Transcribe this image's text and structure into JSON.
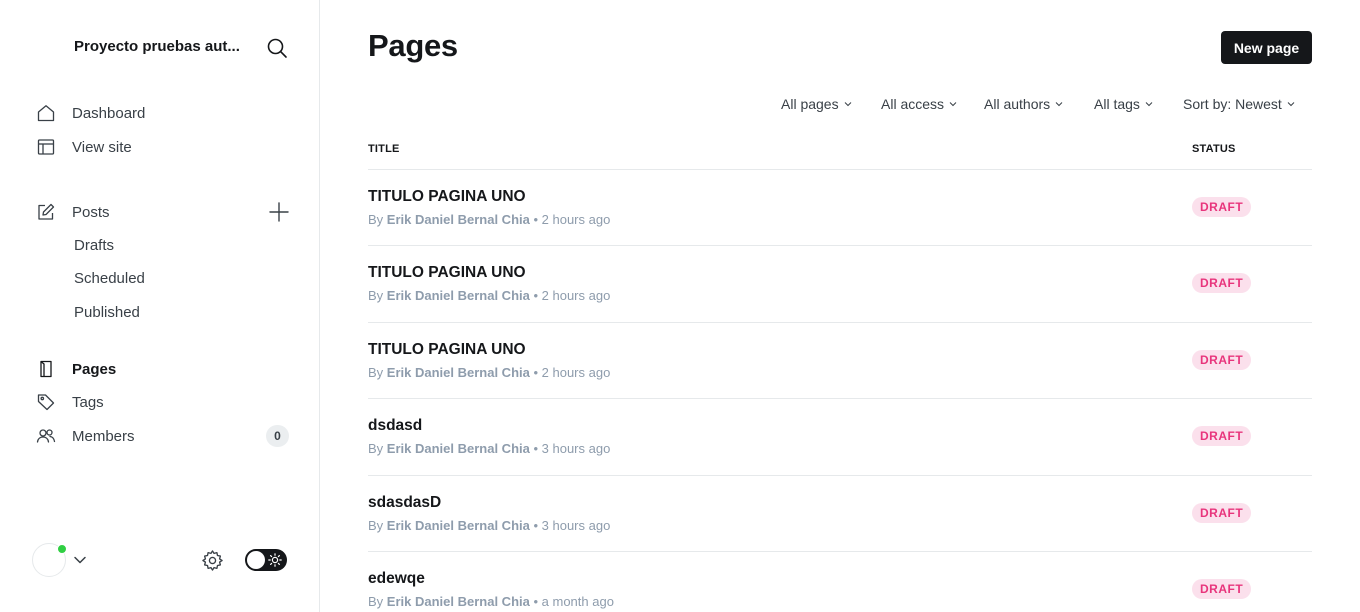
{
  "sidebar": {
    "site_title": "Proyecto pruebas aut...",
    "nav": {
      "dashboard": "Dashboard",
      "view_site": "View site",
      "posts": "Posts",
      "drafts": "Drafts",
      "scheduled": "Scheduled",
      "published": "Published",
      "pages": "Pages",
      "tags": "Tags",
      "members": "Members"
    },
    "members_count": "0",
    "active_item": "pages",
    "icons": [
      "search-icon",
      "home-icon",
      "layout-icon",
      "edit-icon",
      "plus-icon",
      "page-icon",
      "tag-icon",
      "members-icon",
      "chevron-down-icon",
      "gear-icon",
      "sun-icon"
    ]
  },
  "main": {
    "title": "Pages",
    "new_button": "New page",
    "filters": {
      "type": "All pages",
      "access": "All access",
      "authors": "All authors",
      "tags": "All tags",
      "sort": "Sort by: Newest"
    },
    "columns": {
      "title": "TITLE",
      "status": "STATUS"
    },
    "rows": [
      {
        "title": "TITULO PAGINA UNO",
        "by": "By",
        "author": "Erik Daniel Bernal Chia",
        "time": "• 2 hours ago",
        "status": "DRAFT"
      },
      {
        "title": "TITULO PAGINA UNO",
        "by": "By",
        "author": "Erik Daniel Bernal Chia",
        "time": "• 2 hours ago",
        "status": "DRAFT"
      },
      {
        "title": "TITULO PAGINA UNO",
        "by": "By",
        "author": "Erik Daniel Bernal Chia",
        "time": "• 2 hours ago",
        "status": "DRAFT"
      },
      {
        "title": "dsdasd",
        "by": "By",
        "author": "Erik Daniel Bernal Chia",
        "time": "• 3 hours ago",
        "status": "DRAFT"
      },
      {
        "title": "sdasdasD",
        "by": "By",
        "author": "Erik Daniel Bernal Chia",
        "time": "• 3 hours ago",
        "status": "DRAFT"
      },
      {
        "title": "edewqe",
        "by": "By",
        "author": "Erik Daniel Bernal Chia",
        "time": "• a month ago",
        "status": "DRAFT"
      }
    ]
  },
  "colors": {
    "accent_dark": "#15171a",
    "draft_bg": "#fbe0ec",
    "draft_text": "#e8357c",
    "online": "#30cf43",
    "muted_text": "#8e9cac",
    "border": "#e6e9eb"
  }
}
